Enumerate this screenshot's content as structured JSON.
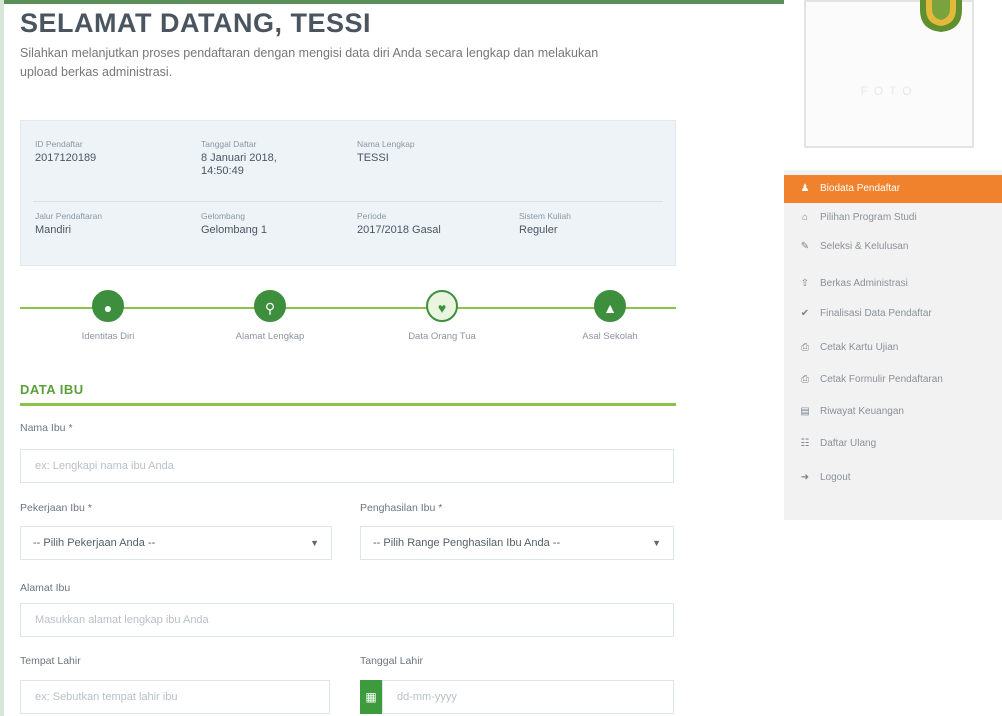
{
  "header": {
    "title": "SELAMAT DATANG, TESSI",
    "intro": "Silahkan melanjutkan proses pendaftaran dengan mengisi data diri Anda secara lengkap dan melakukan upload berkas administrasi."
  },
  "registration": {
    "row1": [
      {
        "label": "ID Pendaftar",
        "value": "2017120189"
      },
      {
        "label": "Tanggal Daftar",
        "value": "8 Januari 2018, 14:50:49"
      },
      {
        "label": "Nama Lengkap",
        "value": "TESSI"
      }
    ],
    "row2": [
      {
        "label": "Jalur Pendaftaran",
        "value": "Mandiri"
      },
      {
        "label": "Gelombang",
        "value": "Gelombang 1"
      },
      {
        "label": "Periode",
        "value": "2017/2018 Gasal"
      },
      {
        "label": "Sistem Kuliah",
        "value": "Reguler"
      }
    ]
  },
  "steps": [
    {
      "label": "Identitas Diri",
      "icon": "person-icon",
      "glyph": "●"
    },
    {
      "label": "Alamat Lengkap",
      "icon": "location-pin-icon",
      "glyph": "⚲"
    },
    {
      "label": "Data Orang Tua",
      "icon": "parents-icon",
      "glyph": "♥"
    },
    {
      "label": "Asal Sekolah",
      "icon": "graduation-cap-icon",
      "glyph": "▲"
    }
  ],
  "section": {
    "title": "DATA IBU"
  },
  "form": {
    "nama_ibu": {
      "label": "Nama Ibu *",
      "placeholder": "ex: Lengkapi nama ibu Anda"
    },
    "pekerjaan_ibu": {
      "label": "Pekerjaan Ibu *",
      "value": "-- Pilih Pekerjaan Anda --"
    },
    "penghasilan_ibu": {
      "label": "Penghasilan Ibu *",
      "value": "-- Pilih Range Penghasilan Ibu Anda --"
    },
    "alamat_ibu": {
      "label": "Alamat Ibu",
      "placeholder": "Masukkan alamat lengkap ibu Anda"
    },
    "tempat_lahir": {
      "label": "Tempat Lahir",
      "placeholder": "ex: Sebutkan tempat lahir ibu"
    },
    "tanggal_lahir": {
      "label": "Tanggal Lahir",
      "placeholder": "dd-mm-yyyy"
    }
  },
  "sidebar": {
    "photo_text": "FOTO",
    "items": [
      {
        "label": "Biodata Pendaftar",
        "icon": "user-icon",
        "glyph": "♟",
        "active": true
      },
      {
        "label": "Pilihan Program Studi",
        "icon": "home-icon",
        "glyph": "⌂",
        "active": false
      },
      {
        "label": "Seleksi & Kelulusan",
        "icon": "edit-icon",
        "glyph": "✎",
        "active": false
      },
      {
        "label": "Berkas Administrasi",
        "icon": "upload-icon",
        "glyph": "⇧",
        "active": false
      },
      {
        "label": "Finalisasi Data Pendaftar",
        "icon": "check-icon",
        "glyph": "✔",
        "active": false
      },
      {
        "label": "Cetak Kartu Ujian",
        "icon": "print-icon",
        "glyph": "⎙",
        "active": false
      },
      {
        "label": "Cetak Formulir Pendaftaran",
        "icon": "print-icon",
        "glyph": "⎙",
        "active": false
      },
      {
        "label": "Riwayat Keuangan",
        "icon": "money-icon",
        "glyph": "▤",
        "active": false
      },
      {
        "label": "Daftar Ulang",
        "icon": "register-icon",
        "glyph": "☷",
        "active": false
      },
      {
        "label": "Logout",
        "icon": "logout-icon",
        "glyph": "➜",
        "active": false
      }
    ]
  },
  "colors": {
    "accent_green": "#3d8f3d",
    "line_green": "#8ac24a",
    "menu_active": "#f0822d"
  }
}
